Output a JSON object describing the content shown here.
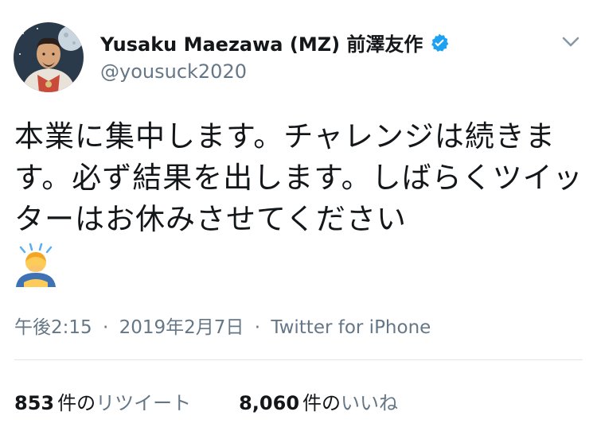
{
  "author": {
    "display_name": "Yusaku Maezawa (MZ) 前澤友作",
    "handle": "@yousuck2020",
    "verified_icon": "verified-badge-icon"
  },
  "tweet": {
    "text": "本業に集中します。チャレンジは続きます。必ず結果を出します。しばらくツイッターはお休みさせてください",
    "emoji": "man-bowing-emoji",
    "time": "午後2:15",
    "date": "2019年2月7日",
    "source": "Twitter for iPhone"
  },
  "stats": {
    "retweets_count": "853",
    "retweets_unit": "件の",
    "retweets_label": "リツイート",
    "likes_count": "8,060",
    "likes_unit": "件の",
    "likes_label": "いいね"
  },
  "colors": {
    "text": "#14171a",
    "muted": "#657786",
    "verified_blue": "#1da1f2",
    "divider": "#e1e8ed"
  }
}
